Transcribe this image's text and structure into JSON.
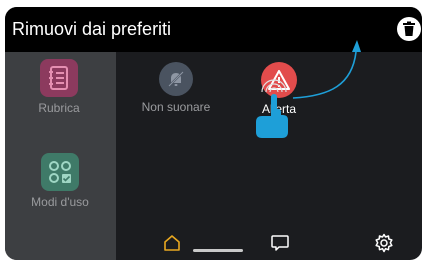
{
  "header": {
    "title": "Rimuovi dai preferiti",
    "trash_icon": "trash-icon"
  },
  "sidebar": {
    "items": [
      {
        "label": "Rubrica",
        "icon": "address-book-icon",
        "color": "#8c3a5e"
      },
      {
        "label": "Modi d'uso",
        "icon": "modes-icon",
        "color": "#3f7a68"
      }
    ]
  },
  "favorites": {
    "items": [
      {
        "label": "Non suonare",
        "icon": "bell-off-icon",
        "color": "#4a5360"
      },
      {
        "label": "Allerta",
        "icon": "warning-icon",
        "color": "#e24c4c"
      }
    ]
  },
  "navbar": {
    "items": [
      {
        "icon": "home-icon",
        "color": "#e9a820"
      },
      {
        "icon": "chat-icon",
        "color": "#ffffff"
      },
      {
        "icon": "gear-icon",
        "color": "#ffffff"
      }
    ]
  },
  "gesture": {
    "icon": "tap-hand-icon",
    "color": "#1e9fd8"
  }
}
